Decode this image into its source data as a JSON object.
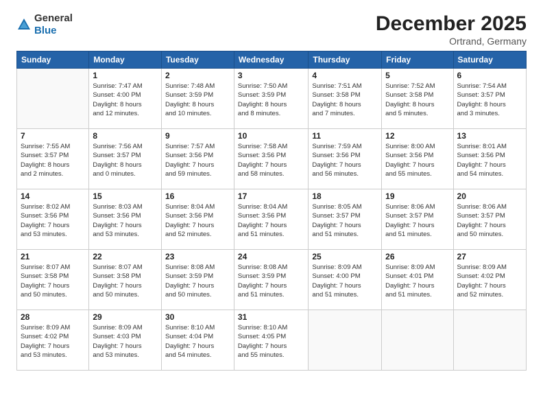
{
  "logo": {
    "general": "General",
    "blue": "Blue"
  },
  "header": {
    "title": "December 2025",
    "subtitle": "Ortrand, Germany"
  },
  "weekdays": [
    "Sunday",
    "Monday",
    "Tuesday",
    "Wednesday",
    "Thursday",
    "Friday",
    "Saturday"
  ],
  "weeks": [
    [
      {
        "day": "",
        "info": ""
      },
      {
        "day": "1",
        "info": "Sunrise: 7:47 AM\nSunset: 4:00 PM\nDaylight: 8 hours\nand 12 minutes."
      },
      {
        "day": "2",
        "info": "Sunrise: 7:48 AM\nSunset: 3:59 PM\nDaylight: 8 hours\nand 10 minutes."
      },
      {
        "day": "3",
        "info": "Sunrise: 7:50 AM\nSunset: 3:59 PM\nDaylight: 8 hours\nand 8 minutes."
      },
      {
        "day": "4",
        "info": "Sunrise: 7:51 AM\nSunset: 3:58 PM\nDaylight: 8 hours\nand 7 minutes."
      },
      {
        "day": "5",
        "info": "Sunrise: 7:52 AM\nSunset: 3:58 PM\nDaylight: 8 hours\nand 5 minutes."
      },
      {
        "day": "6",
        "info": "Sunrise: 7:54 AM\nSunset: 3:57 PM\nDaylight: 8 hours\nand 3 minutes."
      }
    ],
    [
      {
        "day": "7",
        "info": "Sunrise: 7:55 AM\nSunset: 3:57 PM\nDaylight: 8 hours\nand 2 minutes."
      },
      {
        "day": "8",
        "info": "Sunrise: 7:56 AM\nSunset: 3:57 PM\nDaylight: 8 hours\nand 0 minutes."
      },
      {
        "day": "9",
        "info": "Sunrise: 7:57 AM\nSunset: 3:56 PM\nDaylight: 7 hours\nand 59 minutes."
      },
      {
        "day": "10",
        "info": "Sunrise: 7:58 AM\nSunset: 3:56 PM\nDaylight: 7 hours\nand 58 minutes."
      },
      {
        "day": "11",
        "info": "Sunrise: 7:59 AM\nSunset: 3:56 PM\nDaylight: 7 hours\nand 56 minutes."
      },
      {
        "day": "12",
        "info": "Sunrise: 8:00 AM\nSunset: 3:56 PM\nDaylight: 7 hours\nand 55 minutes."
      },
      {
        "day": "13",
        "info": "Sunrise: 8:01 AM\nSunset: 3:56 PM\nDaylight: 7 hours\nand 54 minutes."
      }
    ],
    [
      {
        "day": "14",
        "info": "Sunrise: 8:02 AM\nSunset: 3:56 PM\nDaylight: 7 hours\nand 53 minutes."
      },
      {
        "day": "15",
        "info": "Sunrise: 8:03 AM\nSunset: 3:56 PM\nDaylight: 7 hours\nand 53 minutes."
      },
      {
        "day": "16",
        "info": "Sunrise: 8:04 AM\nSunset: 3:56 PM\nDaylight: 7 hours\nand 52 minutes."
      },
      {
        "day": "17",
        "info": "Sunrise: 8:04 AM\nSunset: 3:56 PM\nDaylight: 7 hours\nand 51 minutes."
      },
      {
        "day": "18",
        "info": "Sunrise: 8:05 AM\nSunset: 3:57 PM\nDaylight: 7 hours\nand 51 minutes."
      },
      {
        "day": "19",
        "info": "Sunrise: 8:06 AM\nSunset: 3:57 PM\nDaylight: 7 hours\nand 51 minutes."
      },
      {
        "day": "20",
        "info": "Sunrise: 8:06 AM\nSunset: 3:57 PM\nDaylight: 7 hours\nand 50 minutes."
      }
    ],
    [
      {
        "day": "21",
        "info": "Sunrise: 8:07 AM\nSunset: 3:58 PM\nDaylight: 7 hours\nand 50 minutes."
      },
      {
        "day": "22",
        "info": "Sunrise: 8:07 AM\nSunset: 3:58 PM\nDaylight: 7 hours\nand 50 minutes."
      },
      {
        "day": "23",
        "info": "Sunrise: 8:08 AM\nSunset: 3:59 PM\nDaylight: 7 hours\nand 50 minutes."
      },
      {
        "day": "24",
        "info": "Sunrise: 8:08 AM\nSunset: 3:59 PM\nDaylight: 7 hours\nand 51 minutes."
      },
      {
        "day": "25",
        "info": "Sunrise: 8:09 AM\nSunset: 4:00 PM\nDaylight: 7 hours\nand 51 minutes."
      },
      {
        "day": "26",
        "info": "Sunrise: 8:09 AM\nSunset: 4:01 PM\nDaylight: 7 hours\nand 51 minutes."
      },
      {
        "day": "27",
        "info": "Sunrise: 8:09 AM\nSunset: 4:02 PM\nDaylight: 7 hours\nand 52 minutes."
      }
    ],
    [
      {
        "day": "28",
        "info": "Sunrise: 8:09 AM\nSunset: 4:02 PM\nDaylight: 7 hours\nand 53 minutes."
      },
      {
        "day": "29",
        "info": "Sunrise: 8:09 AM\nSunset: 4:03 PM\nDaylight: 7 hours\nand 53 minutes."
      },
      {
        "day": "30",
        "info": "Sunrise: 8:10 AM\nSunset: 4:04 PM\nDaylight: 7 hours\nand 54 minutes."
      },
      {
        "day": "31",
        "info": "Sunrise: 8:10 AM\nSunset: 4:05 PM\nDaylight: 7 hours\nand 55 minutes."
      },
      {
        "day": "",
        "info": ""
      },
      {
        "day": "",
        "info": ""
      },
      {
        "day": "",
        "info": ""
      }
    ]
  ]
}
